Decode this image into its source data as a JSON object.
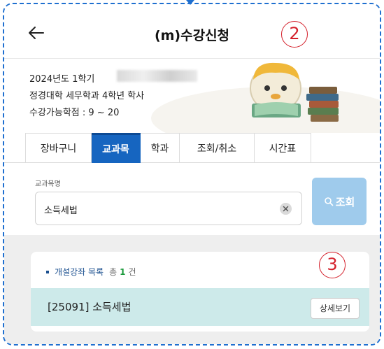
{
  "header": {
    "title": "(m)수강신청",
    "back_icon": "arrow-left-icon",
    "step_badge": "2"
  },
  "student_info": {
    "semester": "2024년도 1학기",
    "department": "정경대학 세무학과 4학년 학사",
    "credits": "수강가능학점 : 9 ~ 20"
  },
  "tabs": [
    {
      "label": "장바구니",
      "active": false
    },
    {
      "label": "교과목",
      "active": true
    },
    {
      "label": "학과",
      "active": false
    },
    {
      "label": "조회/취소",
      "active": false
    },
    {
      "label": "시간표",
      "active": false
    }
  ],
  "search": {
    "label": "교과목명",
    "value": "소득세법",
    "clear_icon": "clear-circle-icon",
    "button_label": "조회",
    "button_icon": "search-icon"
  },
  "results": {
    "title": "개설강좌 목록",
    "count_prefix": "총",
    "count": "1",
    "count_suffix": "건",
    "step_badge": "3",
    "course": "[25091] 소득세법",
    "detail_button": "상세보기"
  },
  "colors": {
    "frame_border": "#1e6fd0",
    "tab_active": "#1665c0",
    "search_button": "#9fcbec",
    "row_highlight": "#cdeaea",
    "badge": "#d4202b"
  }
}
